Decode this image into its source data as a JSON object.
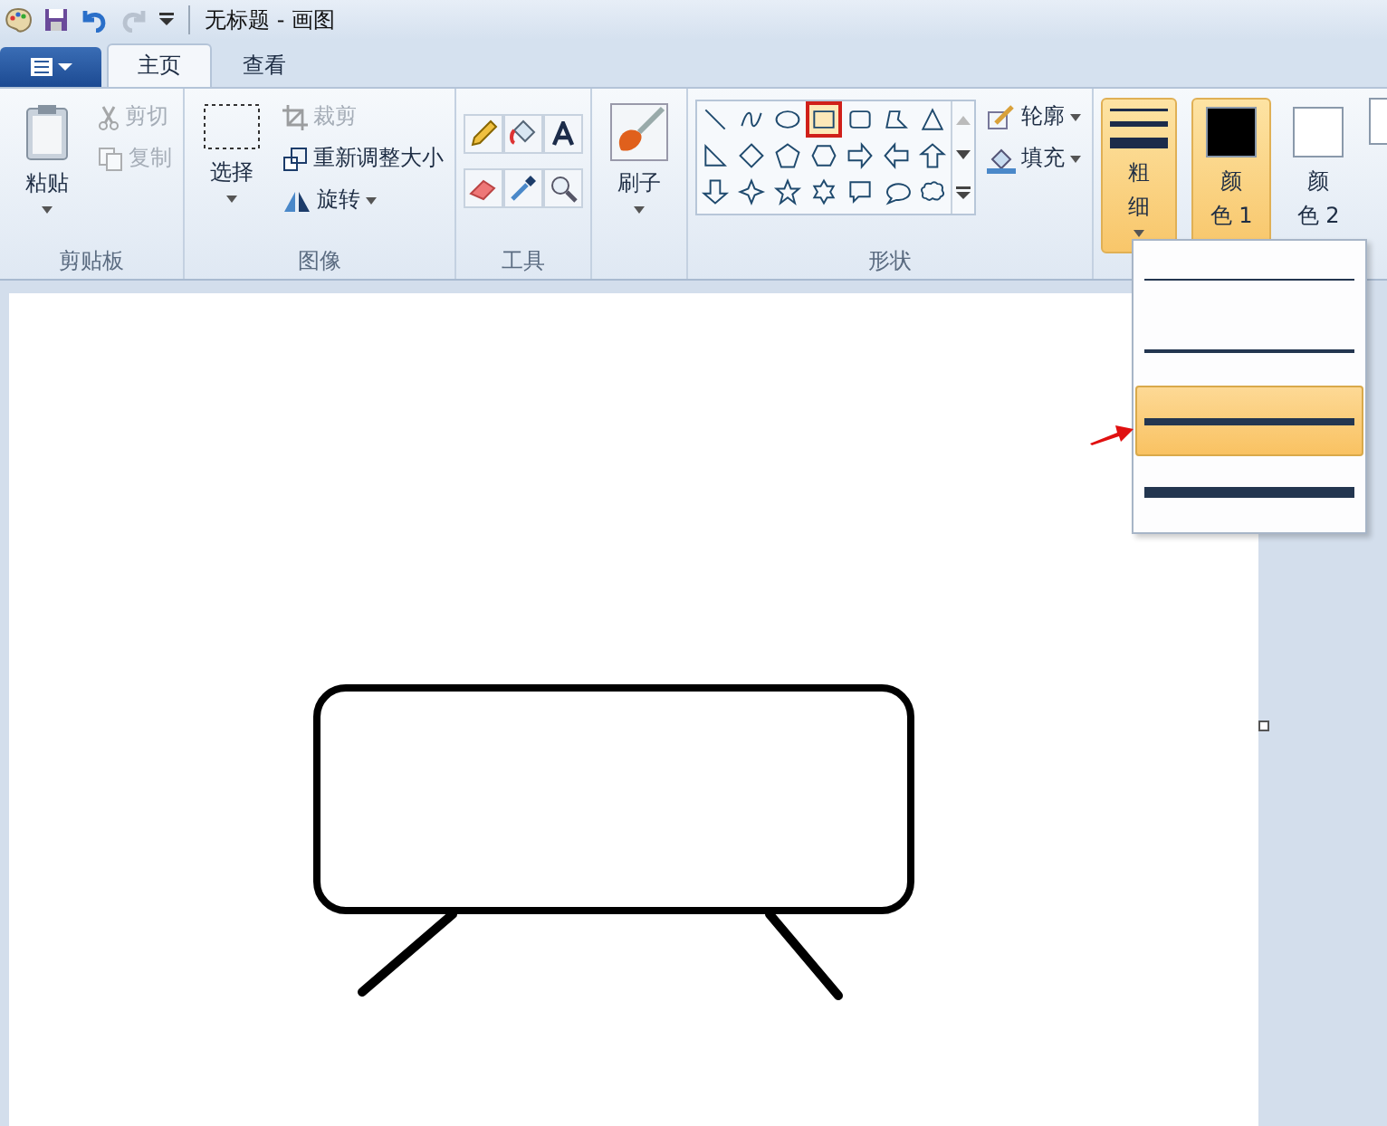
{
  "window": {
    "title": "无标题 - 画图"
  },
  "tabs": [
    {
      "label": "主页",
      "selected": true
    },
    {
      "label": "查看",
      "selected": false
    }
  ],
  "clipboard": {
    "paste": "粘贴",
    "items": [
      {
        "label": "剪切",
        "disabled": true
      },
      {
        "label": "复制",
        "disabled": true
      }
    ],
    "label": "剪贴板"
  },
  "image": {
    "select": "选择",
    "items": [
      {
        "kind": "crop",
        "label": "裁剪",
        "disabled": true
      },
      {
        "kind": "resize",
        "label": "重新调整大小",
        "disabled": false
      },
      {
        "kind": "rotate",
        "label": "旋转",
        "disabled": false
      }
    ],
    "label": "图像"
  },
  "tools": {
    "label": "工具"
  },
  "brushes": {
    "label": "刷子"
  },
  "shapes": {
    "items": [
      {
        "kind": "line",
        "selected": false
      },
      {
        "kind": "curve",
        "selected": false
      },
      {
        "kind": "oval",
        "selected": false
      },
      {
        "kind": "rect",
        "selected": true
      },
      {
        "kind": "roundrect",
        "selected": false
      },
      {
        "kind": "polygon",
        "selected": false
      },
      {
        "kind": "triangle",
        "selected": false
      },
      {
        "kind": "right-triangle",
        "selected": false
      },
      {
        "kind": "diamond",
        "selected": false
      },
      {
        "kind": "pentagon",
        "selected": false
      },
      {
        "kind": "hexagon",
        "selected": false
      },
      {
        "kind": "arrow-right",
        "selected": false
      },
      {
        "kind": "arrow-left",
        "selected": false
      },
      {
        "kind": "arrow-up",
        "selected": false
      },
      {
        "kind": "arrow-down",
        "selected": false
      },
      {
        "kind": "star4",
        "selected": false
      },
      {
        "kind": "star5",
        "selected": false
      },
      {
        "kind": "star6",
        "selected": false
      },
      {
        "kind": "callout-rect",
        "selected": false
      },
      {
        "kind": "callout-oval",
        "selected": false
      },
      {
        "kind": "callout-cloud",
        "selected": false
      }
    ],
    "outline": "轮廓",
    "fill": "填充",
    "label": "形状"
  },
  "size": {
    "label": "粗细",
    "options": [
      {
        "selected": false
      },
      {
        "selected": false
      },
      {
        "selected": true
      },
      {
        "selected": false
      }
    ]
  },
  "colors": [
    {
      "label": "颜色 1",
      "color": "#000000",
      "selected": true
    },
    {
      "label": "颜色 2",
      "color": "#ffffff",
      "selected": false
    }
  ]
}
